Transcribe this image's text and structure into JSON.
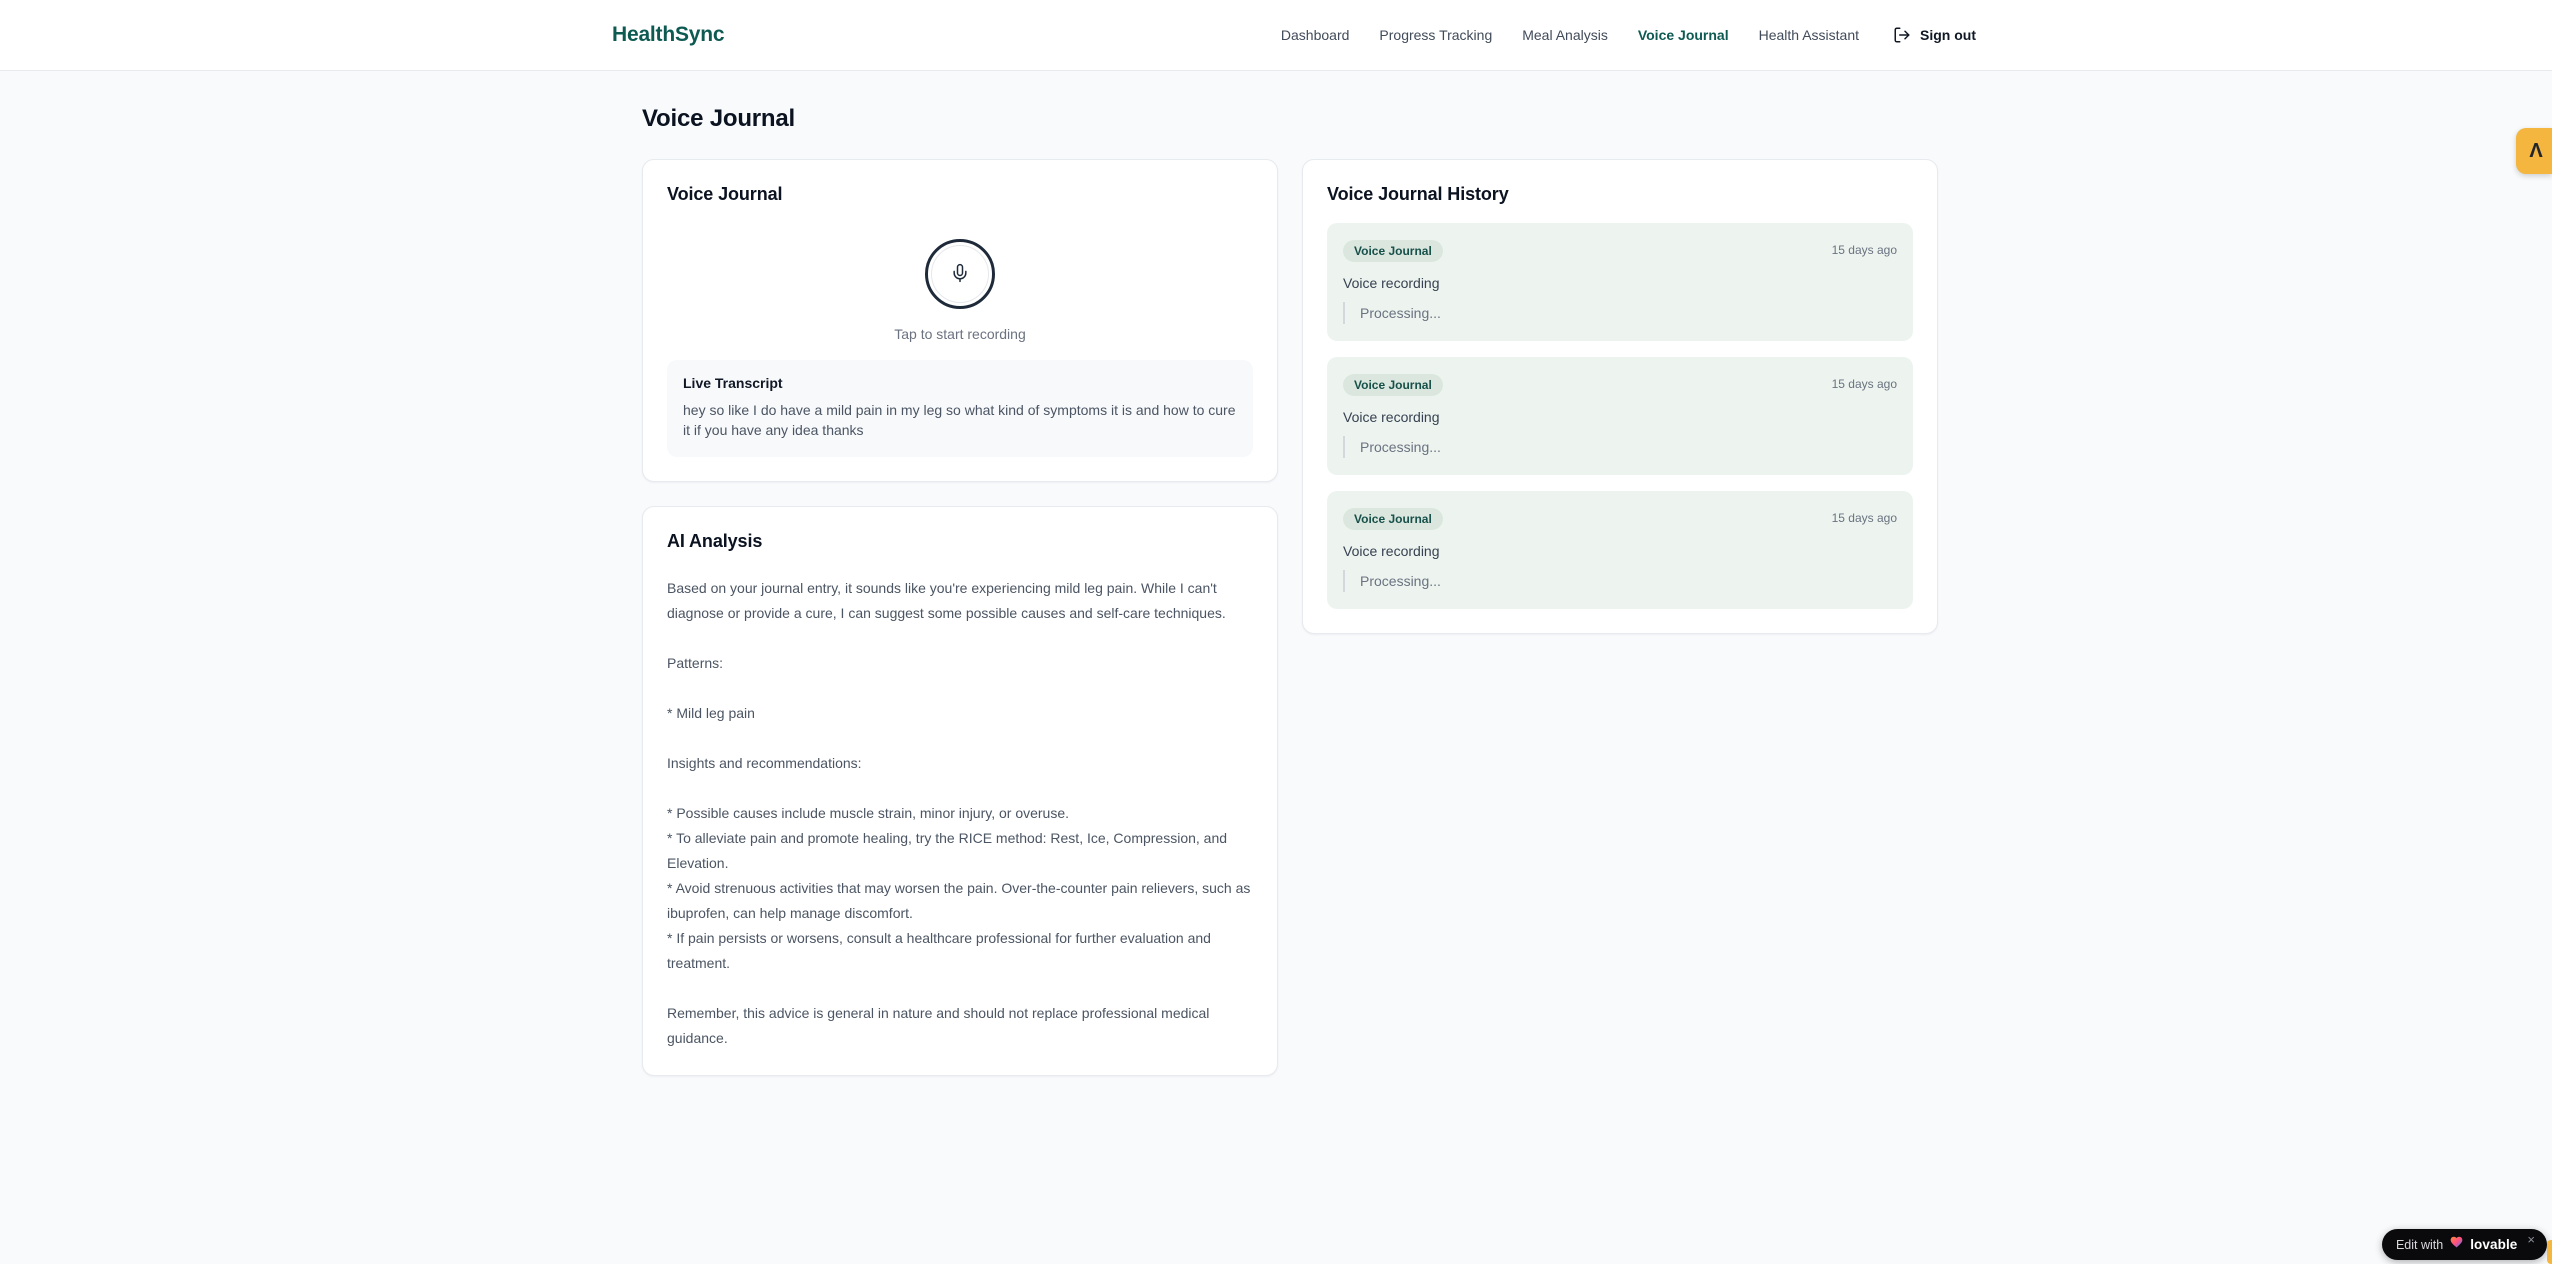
{
  "brand": "HealthSync",
  "nav": {
    "items": [
      {
        "label": "Dashboard",
        "active": false
      },
      {
        "label": "Progress Tracking",
        "active": false
      },
      {
        "label": "Meal Analysis",
        "active": false
      },
      {
        "label": "Voice Journal",
        "active": true
      },
      {
        "label": "Health Assistant",
        "active": false
      }
    ],
    "sign_out_label": "Sign out",
    "sign_out_icon": "logout-icon"
  },
  "page": {
    "title": "Voice Journal"
  },
  "recorder_card": {
    "title": "Voice Journal",
    "mic_icon": "microphone-icon",
    "tap_hint": "Tap to start recording",
    "transcript_title": "Live Transcript",
    "transcript_text": "hey so like I do have a mild pain in my leg so what kind of symptoms it is and how to cure it if you have any idea thanks"
  },
  "analysis_card": {
    "title": "AI Analysis",
    "body": "Based on your journal entry, it sounds like you're experiencing mild leg pain. While I can't diagnose or provide a cure, I can suggest some possible causes and self-care techniques.\n\nPatterns:\n\n* Mild leg pain\n\nInsights and recommendations:\n\n* Possible causes include muscle strain, minor injury, or overuse.\n* To alleviate pain and promote healing, try the RICE method: Rest, Ice, Compression, and Elevation.\n* Avoid strenuous activities that may worsen the pain. Over-the-counter pain relievers, such as ibuprofen, can help manage discomfort.\n* If pain persists or worsens, consult a healthcare professional for further evaluation and treatment.\n\nRemember, this advice is general in nature and should not replace professional medical guidance."
  },
  "history_card": {
    "title": "Voice Journal History",
    "entries": [
      {
        "badge": "Voice Journal",
        "time": "15 days ago",
        "label": "Voice recording",
        "status": "Processing..."
      },
      {
        "badge": "Voice Journal",
        "time": "15 days ago",
        "label": "Voice recording",
        "status": "Processing..."
      },
      {
        "badge": "Voice Journal",
        "time": "15 days ago",
        "label": "Voice recording",
        "status": "Processing..."
      }
    ]
  },
  "edge_widgets": {
    "dev_badge_glyph": "Λ",
    "edit_with": "Edit with",
    "lovable": "lovable",
    "heart_icon": "gradient-heart-icon",
    "close": "×"
  },
  "colors": {
    "brand_teal": "#0d5a52",
    "active_nav": "#0e5a53",
    "page_bg": "#f8fafc",
    "card_border": "#e7eaee",
    "history_entry_bg": "#edf4ef",
    "badge_bg": "#dbe7de",
    "badge_text": "#17504a",
    "muted_text": "#6b7280",
    "body_text": "#4b5563",
    "amber_badge": "#f4b63e",
    "mic_ring": "#1e2a3a"
  }
}
